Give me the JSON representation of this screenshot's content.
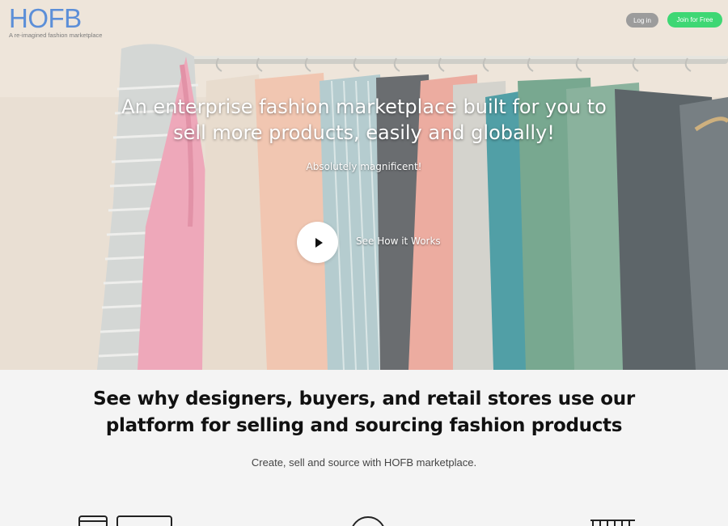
{
  "brand": {
    "name": "HOFB",
    "tagline": "A re-imagined fashion marketplace",
    "color": "#5c8fd8"
  },
  "nav": {
    "login_label": "Log in",
    "join_label": "Join for Free",
    "join_color": "#3ed774"
  },
  "hero": {
    "headline": "An enterprise fashion marketplace built for you to sell more products, easily and globally!",
    "subheadline": "Absolutely magnificent!",
    "video_link": "See How it Works"
  },
  "intro": {
    "title": "See why designers, buyers, and retail stores use our platform for selling and sourcing fashion products",
    "subtitle": "Create, sell and source with HOFB marketplace."
  },
  "icons": [
    "storefront-icon",
    "monitor-icon",
    "circle-icon",
    "shopping-basket-icon"
  ]
}
